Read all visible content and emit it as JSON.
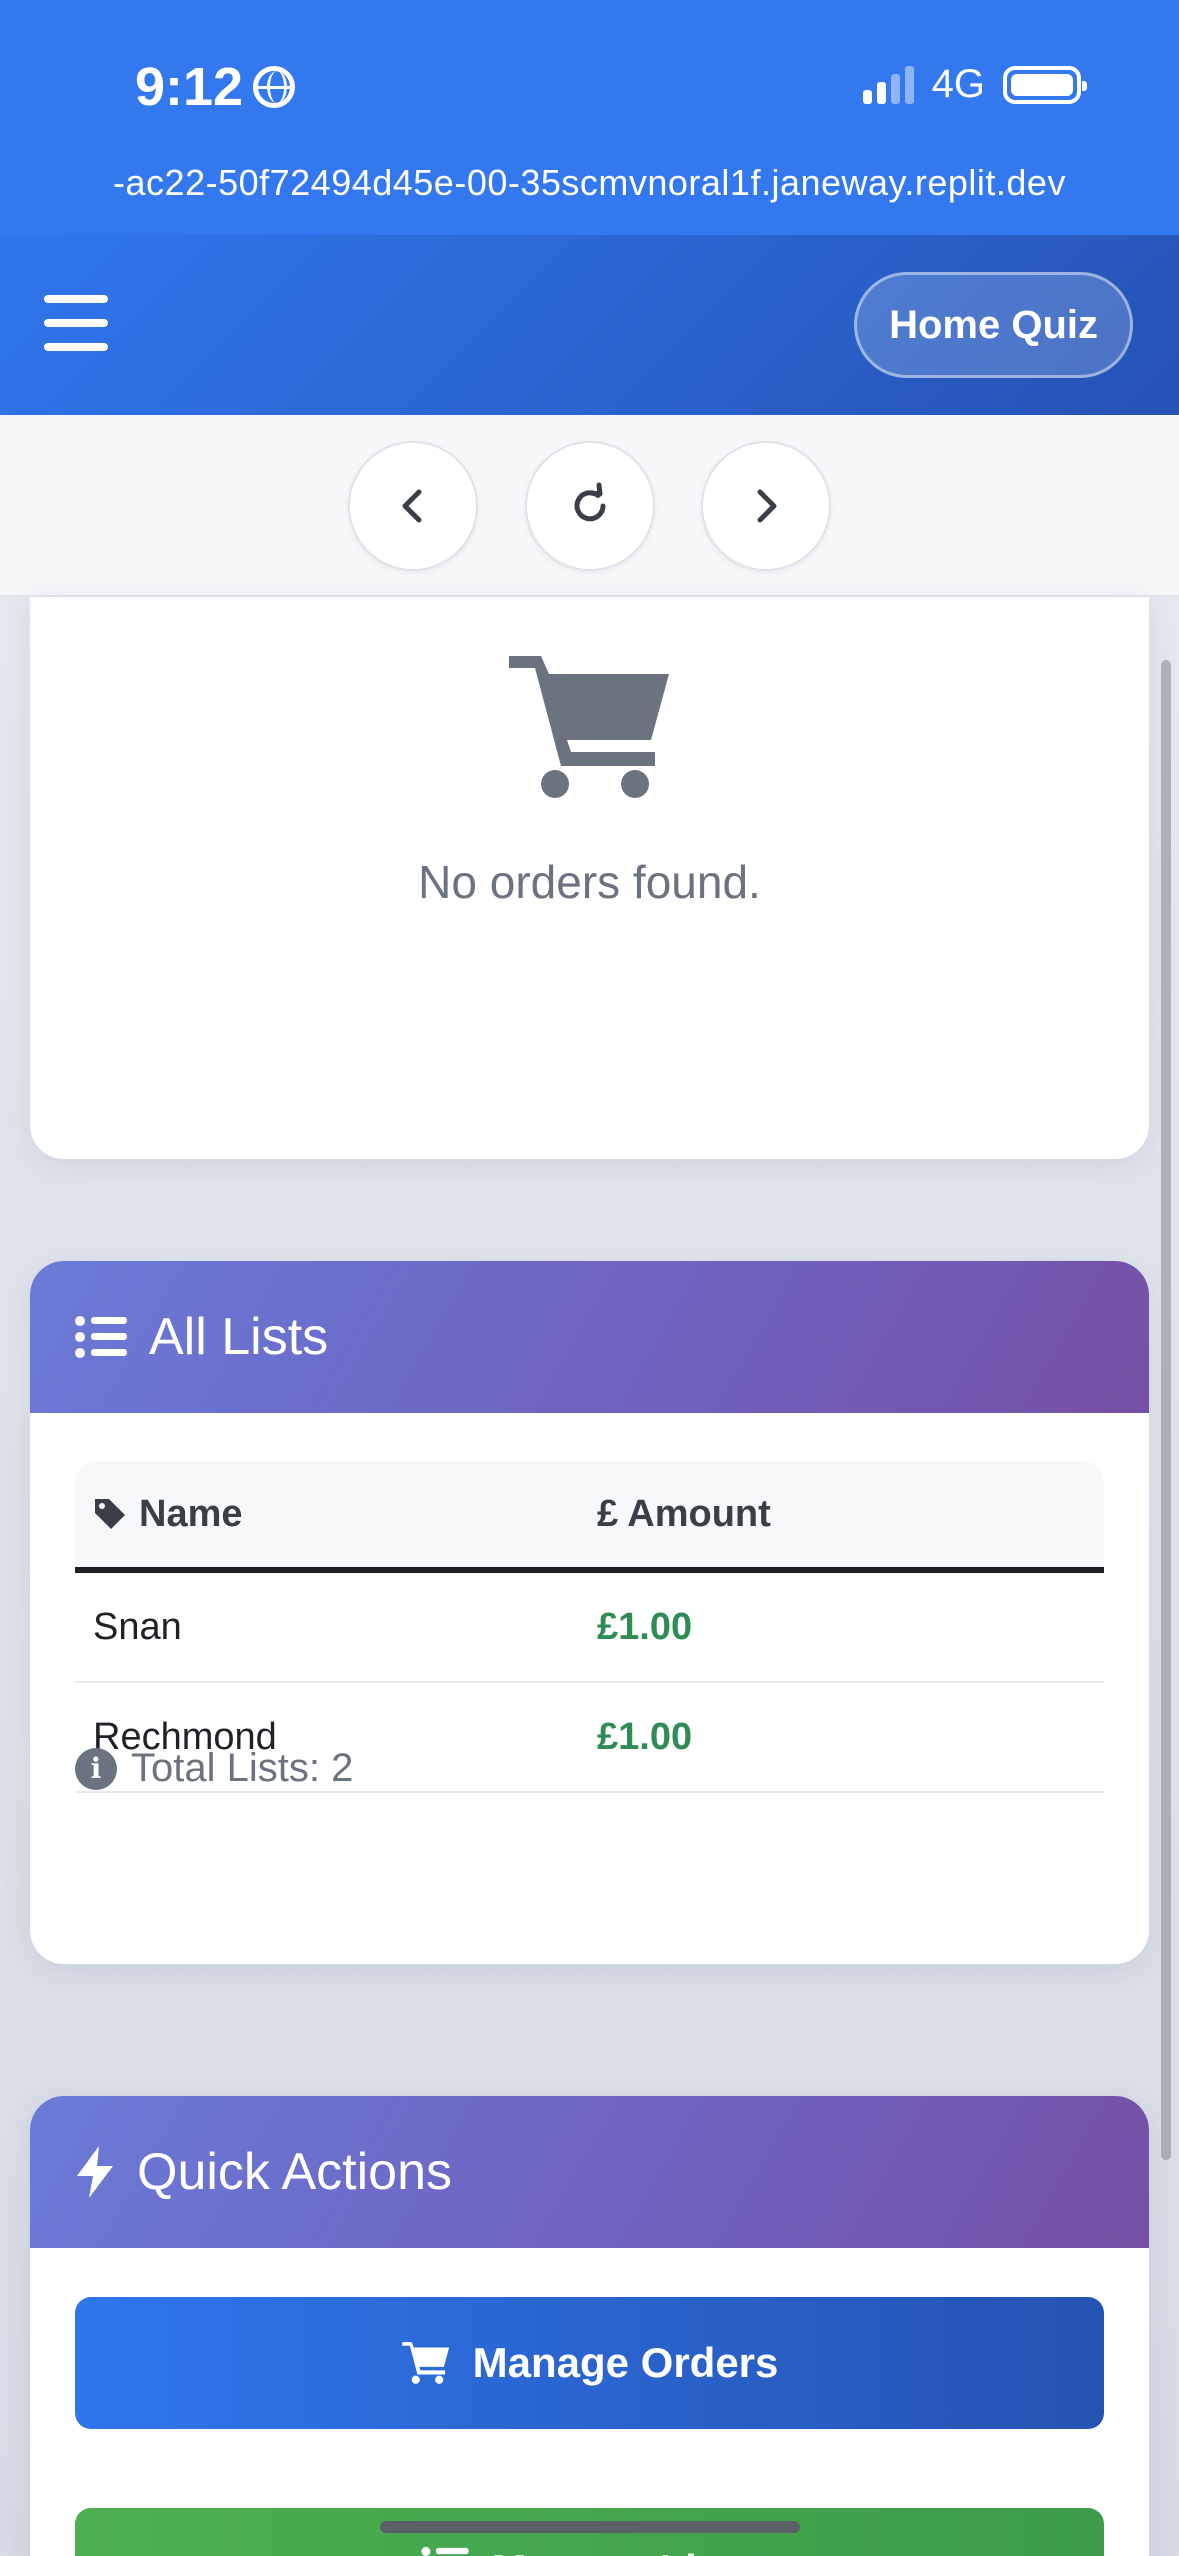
{
  "status": {
    "time": "9:12",
    "network": "4G"
  },
  "browser": {
    "url": "-ac22-50f72494d45e-00-35scmvnoral1f.janeway.replit.dev"
  },
  "header": {
    "home_quiz_label": "Home Quiz"
  },
  "nav": {
    "back_icon": "chevron-left-icon",
    "reload_icon": "reload-icon",
    "forward_icon": "chevron-right-icon"
  },
  "orders": {
    "empty_text": "No orders found.",
    "icon": "shopping-cart-icon"
  },
  "lists": {
    "title": "All Lists",
    "columns": {
      "name": "Name",
      "amount": "£ Amount"
    },
    "rows": [
      {
        "name": "Snan",
        "amount": "£1.00"
      },
      {
        "name": "Rechmond",
        "amount": "£1.00"
      }
    ],
    "total": "Total Lists: 2"
  },
  "quick_actions": {
    "title": "Quick Actions",
    "manage_orders": "Manage Orders",
    "manage_lists": "Manage Lists"
  },
  "colors": {
    "primary": "#3478f0",
    "accent_purple": "#6e63bf",
    "amount_green": "#2f8c55",
    "success": "#4caf50"
  }
}
